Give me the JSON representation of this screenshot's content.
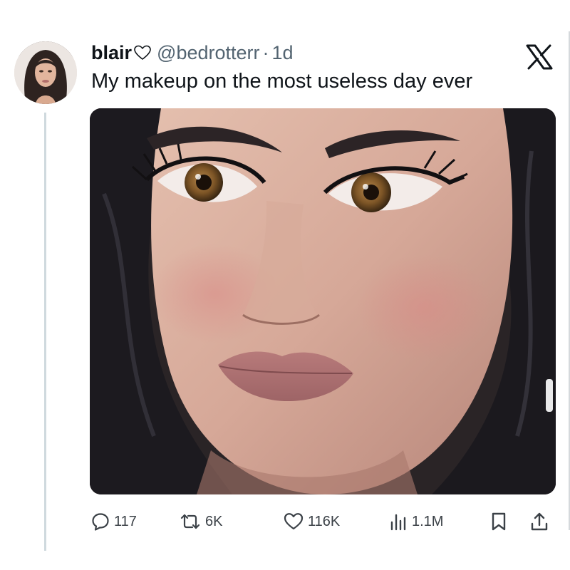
{
  "tweet": {
    "display_name": "blair",
    "name_emoji": "heart-outline",
    "handle": "@bedrotterr",
    "separator": "·",
    "time_ago": "1d",
    "text": "My makeup on the most useless day ever"
  },
  "actions": {
    "replies": "117",
    "reposts": "6K",
    "likes": "116K",
    "views": "1.1M"
  },
  "icons": {
    "platform_logo": "x-logo-icon",
    "reply": "reply-bubble-icon",
    "repost": "repost-arrows-icon",
    "like": "heart-icon",
    "views": "analytics-bars-icon",
    "bookmark": "bookmark-icon",
    "share": "share-upload-icon"
  },
  "colors": {
    "text_primary": "#0f1419",
    "text_secondary": "#536471",
    "action_gray": "#3b4147",
    "thread_line": "#cfd9de"
  }
}
